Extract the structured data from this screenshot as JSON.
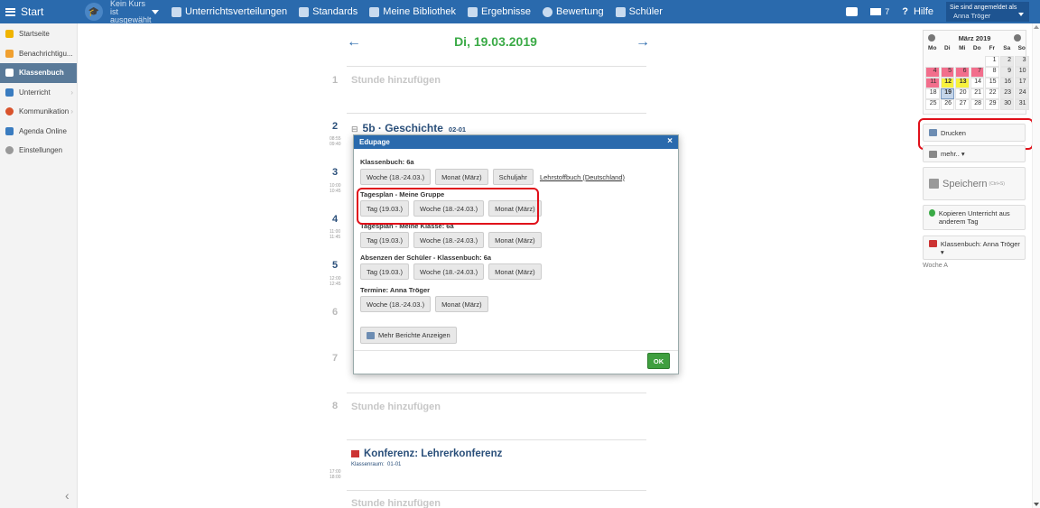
{
  "topbar": {
    "start": "Start",
    "course_line1": "Kein Kurs ist",
    "course_line2": "ausgewählt",
    "nav": [
      "Unterrichtsverteilungen",
      "Standards",
      "Meine Bibliothek",
      "Ergebnisse",
      "Bewertung",
      "Schüler"
    ],
    "mail_count": "7",
    "help": "Hilfe",
    "logged_in_label": "Sie sind angemeldet als",
    "user_name": "Anna Tröger"
  },
  "sidebar": {
    "items": [
      {
        "label": "Startseite",
        "icon": "star-icon",
        "color": "#f0b400"
      },
      {
        "label": "Benachrichtigu...",
        "icon": "envelope-icon",
        "color": "#f0a030"
      },
      {
        "label": "Klassenbuch",
        "icon": "book-icon",
        "color": "#ffffff"
      },
      {
        "label": "Unterricht",
        "icon": "briefcase-icon",
        "color": "#3a7cc0"
      },
      {
        "label": "Kommunikation",
        "icon": "chat-icon",
        "color": "#d9532c"
      },
      {
        "label": "Agenda Online",
        "icon": "pencil-icon",
        "color": "#3a7cc0"
      },
      {
        "label": "Einstellungen",
        "icon": "gear-icon",
        "color": "#888888"
      }
    ],
    "collapse": "‹"
  },
  "main": {
    "date": "Di, 19.03.2019",
    "prev": "←",
    "next": "→",
    "add_lesson": "Stunde hinzufügen",
    "lesson_numbers": [
      "1",
      "2",
      "3",
      "4",
      "5",
      "6",
      "7",
      "8"
    ],
    "times": {
      "t2": [
        "08:55",
        "09:40"
      ],
      "t3": [
        "10:00",
        "10:45"
      ],
      "t4": [
        "11:00",
        "11:45"
      ],
      "t5": [
        "12:00",
        "12:45"
      ],
      "t_conf": [
        "17:00",
        "18:00"
      ]
    },
    "lesson_title": "5b · Geschichte",
    "lesson_room": "02-01",
    "conference_title": "Konferenz: Lehrerkonferenz",
    "conference_room_label": "Klassenraum:",
    "conference_room": "01-01"
  },
  "dialog": {
    "title": "Edupage",
    "close": "×",
    "sections": [
      {
        "title": "Klassenbuch: 6a",
        "buttons": [
          "Woche (18.-24.03.)",
          "Monat (März)",
          "Schuljahr"
        ],
        "link": "Lehrstoffbuch (Deutschland)"
      },
      {
        "title": "Tagesplan - Meine Gruppe",
        "buttons": [
          "Tag (19.03.)",
          "Woche (18.-24.03.)",
          "Monat (März)"
        ]
      },
      {
        "title": "Tagesplan - Meine Klasse: 6a",
        "buttons": [
          "Tag (19.03.)",
          "Woche (18.-24.03.)",
          "Monat (März)"
        ]
      },
      {
        "title": "Absenzen der Schüler - Klassenbuch: 6a",
        "buttons": [
          "Tag (19.03.)",
          "Woche (18.-24.03.)",
          "Monat (März)"
        ]
      },
      {
        "title": "Termine: Anna Tröger",
        "buttons": [
          "Woche (18.-24.03.)",
          "Monat (März)"
        ]
      }
    ],
    "more_reports": "Mehr Berichte Anzeigen",
    "ok": "OK"
  },
  "calendar": {
    "month": "März 2019",
    "weekdays": [
      "Mo",
      "Di",
      "Mi",
      "Do",
      "Fr",
      "Sa",
      "So"
    ],
    "days": [
      {
        "n": "",
        "s": "empty"
      },
      {
        "n": "",
        "s": "empty"
      },
      {
        "n": "",
        "s": "empty"
      },
      {
        "n": "",
        "s": "empty"
      },
      {
        "n": "1",
        "s": ""
      },
      {
        "n": "2",
        "s": "gray"
      },
      {
        "n": "3",
        "s": "gray"
      },
      {
        "n": "4",
        "s": "pink"
      },
      {
        "n": "5",
        "s": "pink"
      },
      {
        "n": "6",
        "s": "pink"
      },
      {
        "n": "7",
        "s": "pink"
      },
      {
        "n": "8",
        "s": ""
      },
      {
        "n": "9",
        "s": "gray"
      },
      {
        "n": "10",
        "s": "gray"
      },
      {
        "n": "11",
        "s": "pink"
      },
      {
        "n": "12",
        "s": "yellow"
      },
      {
        "n": "13",
        "s": "yellow"
      },
      {
        "n": "14",
        "s": ""
      },
      {
        "n": "15",
        "s": ""
      },
      {
        "n": "16",
        "s": "gray"
      },
      {
        "n": "17",
        "s": "gray"
      },
      {
        "n": "18",
        "s": ""
      },
      {
        "n": "19",
        "s": "today"
      },
      {
        "n": "20",
        "s": ""
      },
      {
        "n": "21",
        "s": ""
      },
      {
        "n": "22",
        "s": ""
      },
      {
        "n": "23",
        "s": "gray"
      },
      {
        "n": "24",
        "s": "gray"
      },
      {
        "n": "25",
        "s": ""
      },
      {
        "n": "26",
        "s": ""
      },
      {
        "n": "27",
        "s": ""
      },
      {
        "n": "28",
        "s": ""
      },
      {
        "n": "29",
        "s": ""
      },
      {
        "n": "30",
        "s": "gray"
      },
      {
        "n": "31",
        "s": "gray"
      }
    ]
  },
  "right_panel": {
    "print": "Drucken",
    "more": "mehr.. ▾",
    "save": "Speichern",
    "save_shortcut": "(Ctrl+S)",
    "copy": "Kopieren Unterricht aus anderem Tag",
    "classbook": "Klassenbuch: Anna Tröger ▾",
    "week": "Woche A"
  },
  "colors": {
    "topbar": "#2a6aad",
    "accent_green": "#3aaa46",
    "highlight_red": "#e0101a"
  }
}
